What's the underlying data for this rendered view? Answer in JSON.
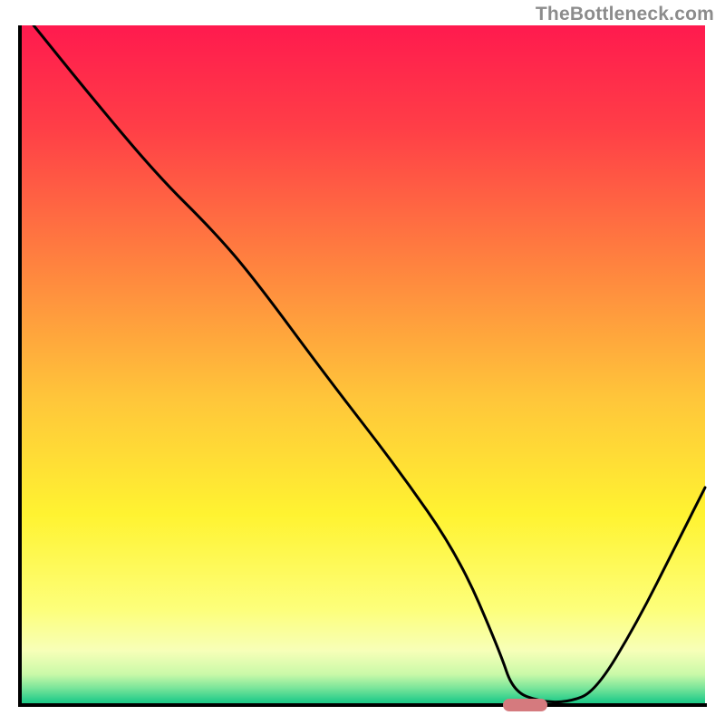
{
  "watermark": "TheBottleneck.com",
  "colors": {
    "watermark_text": "#8c8c8c",
    "axis": "#000000",
    "curve": "#000000",
    "marker": "#d57a7e",
    "gradient_stops": [
      {
        "offset": 0.0,
        "color": "#ff1a4e"
      },
      {
        "offset": 0.15,
        "color": "#ff3e47"
      },
      {
        "offset": 0.35,
        "color": "#ff823f"
      },
      {
        "offset": 0.55,
        "color": "#ffc63a"
      },
      {
        "offset": 0.72,
        "color": "#fff331"
      },
      {
        "offset": 0.86,
        "color": "#fdff7b"
      },
      {
        "offset": 0.92,
        "color": "#f7ffb8"
      },
      {
        "offset": 0.955,
        "color": "#c9f9a8"
      },
      {
        "offset": 0.975,
        "color": "#7ae59a"
      },
      {
        "offset": 0.992,
        "color": "#2ecf8c"
      },
      {
        "offset": 1.0,
        "color": "#17c884"
      }
    ]
  },
  "axes": {
    "x_range": [
      0,
      100
    ],
    "y_range": [
      0,
      100
    ]
  },
  "chart_data": {
    "type": "line",
    "title": "",
    "xlabel": "",
    "ylabel": "",
    "xlim": [
      0,
      100
    ],
    "ylim": [
      0,
      100
    ],
    "x": [
      2,
      10,
      20,
      28,
      34,
      45,
      55,
      64,
      70,
      72,
      76,
      80,
      84,
      90,
      96,
      100
    ],
    "values": [
      100,
      90,
      78,
      70,
      63,
      48,
      35,
      22,
      8,
      2,
      0.5,
      0.4,
      2,
      12,
      24,
      32
    ],
    "marker": {
      "x_start": 70.5,
      "x_end": 77,
      "y": 0.4
    },
    "gridlines": false,
    "legend": false
  }
}
